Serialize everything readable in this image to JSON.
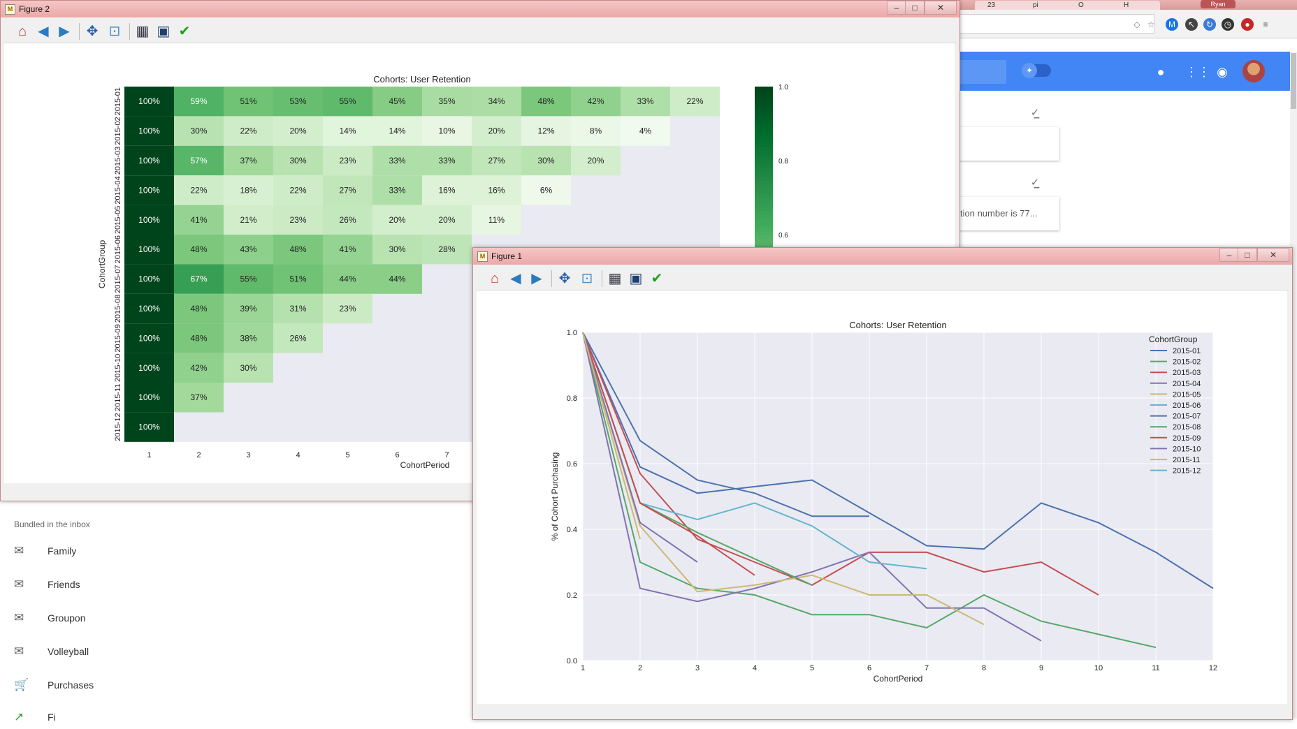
{
  "browser": {
    "tabs": [
      "23",
      "pi",
      "O",
      "H"
    ],
    "profile_label": "Ryan",
    "extension_icons": [
      "eye-slash-icon",
      "star-icon",
      "m-icon",
      "cursor-icon",
      "refresh-icon",
      "clock-icon",
      "shield-icon",
      "menu-icon"
    ]
  },
  "inbox": {
    "card1_text": "",
    "card2_text": "tion number is 77...",
    "bundles_title": "Bundled in the inbox",
    "bundles": [
      {
        "label": "Family",
        "icon": "mail-icon"
      },
      {
        "label": "Friends",
        "icon": "mail-icon"
      },
      {
        "label": "Groupon",
        "icon": "mail-icon"
      },
      {
        "label": "Volleyball",
        "icon": "mail-icon"
      },
      {
        "label": "Purchases",
        "icon": "cart-icon"
      },
      {
        "label": "Fi",
        "icon": "trend-icon"
      }
    ]
  },
  "figure2": {
    "window_title": "Figure 2",
    "toolbar": [
      "home-icon",
      "back-icon",
      "forward-icon",
      "pan-icon",
      "zoom-icon",
      "subplots-icon",
      "save-icon",
      "check-icon"
    ]
  },
  "figure1": {
    "window_title": "Figure 1",
    "toolbar": [
      "home-icon",
      "back-icon",
      "forward-icon",
      "pan-icon",
      "zoom-icon",
      "subplots-icon",
      "save-icon",
      "check-icon"
    ]
  },
  "colors": {
    "heat_low": "#f7fcf5",
    "heat_high": "#00441b",
    "plot_bg": "#eaeaf2",
    "series": [
      "#4c72b0",
      "#55a868",
      "#c44e52",
      "#8172b2",
      "#ccb974",
      "#64b5cd",
      "#4c72b0",
      "#55a868",
      "#c44e52",
      "#8172b2",
      "#ccb974",
      "#64b5cd"
    ]
  },
  "chart_data": [
    {
      "type": "heatmap",
      "title": "Cohorts: User Retention",
      "xlabel": "CohortPeriod",
      "ylabel": "CohortGroup",
      "x_ticks": [
        "1",
        "2",
        "3",
        "4",
        "5",
        "6",
        "7"
      ],
      "rows": [
        "2015-01",
        "2015-02",
        "2015-03",
        "2015-04",
        "2015-05",
        "2015-06",
        "2015-07",
        "2015-08",
        "2015-09",
        "2015-10",
        "2015-11",
        "2015-12"
      ],
      "values": [
        [
          100,
          59,
          51,
          53,
          55,
          45,
          35,
          34,
          48,
          42,
          33,
          22
        ],
        [
          100,
          30,
          22,
          20,
          14,
          14,
          10,
          20,
          12,
          8,
          4
        ],
        [
          100,
          57,
          37,
          30,
          23,
          33,
          33,
          27,
          30,
          20
        ],
        [
          100,
          22,
          18,
          22,
          27,
          33,
          16,
          16,
          6
        ],
        [
          100,
          41,
          21,
          23,
          26,
          20,
          20,
          11
        ],
        [
          100,
          48,
          43,
          48,
          41,
          30,
          28
        ],
        [
          100,
          67,
          55,
          51,
          44,
          44
        ],
        [
          100,
          48,
          39,
          31,
          23
        ],
        [
          100,
          48,
          38,
          26
        ],
        [
          100,
          42,
          30
        ],
        [
          100,
          37
        ],
        [
          100
        ]
      ],
      "colorbar_ticks": [
        "1.0",
        "0.8",
        "0.6"
      ],
      "vmin": 0,
      "vmax": 1
    },
    {
      "type": "line",
      "title": "Cohorts: User Retention",
      "xlabel": "CohortPeriod",
      "ylabel": "% of Cohort Purchasing",
      "legend_title": "CohortGroup",
      "legend_position": "top-right",
      "xlim": [
        1,
        12
      ],
      "ylim": [
        0.0,
        1.0
      ],
      "x_ticks": [
        "1",
        "2",
        "3",
        "4",
        "5",
        "6",
        "7",
        "8",
        "9",
        "10",
        "11",
        "12"
      ],
      "y_ticks": [
        "0.0",
        "0.2",
        "0.4",
        "0.6",
        "0.8",
        "1.0"
      ],
      "series": [
        {
          "name": "2015-01",
          "values": [
            1.0,
            0.59,
            0.51,
            0.53,
            0.55,
            0.45,
            0.35,
            0.34,
            0.48,
            0.42,
            0.33,
            0.22
          ]
        },
        {
          "name": "2015-02",
          "values": [
            1.0,
            0.3,
            0.22,
            0.2,
            0.14,
            0.14,
            0.1,
            0.2,
            0.12,
            0.08,
            0.04
          ]
        },
        {
          "name": "2015-03",
          "values": [
            1.0,
            0.57,
            0.37,
            0.3,
            0.23,
            0.33,
            0.33,
            0.27,
            0.3,
            0.2
          ]
        },
        {
          "name": "2015-04",
          "values": [
            1.0,
            0.22,
            0.18,
            0.22,
            0.27,
            0.33,
            0.16,
            0.16,
            0.06
          ]
        },
        {
          "name": "2015-05",
          "values": [
            1.0,
            0.41,
            0.21,
            0.23,
            0.26,
            0.2,
            0.2,
            0.11
          ]
        },
        {
          "name": "2015-06",
          "values": [
            1.0,
            0.48,
            0.43,
            0.48,
            0.41,
            0.3,
            0.28
          ]
        },
        {
          "name": "2015-07",
          "values": [
            1.0,
            0.67,
            0.55,
            0.51,
            0.44,
            0.44
          ]
        },
        {
          "name": "2015-08",
          "values": [
            1.0,
            0.48,
            0.39,
            0.31,
            0.23
          ]
        },
        {
          "name": "2015-09",
          "values": [
            1.0,
            0.48,
            0.38,
            0.26
          ]
        },
        {
          "name": "2015-10",
          "values": [
            1.0,
            0.42,
            0.3
          ]
        },
        {
          "name": "2015-11",
          "values": [
            1.0,
            0.37
          ]
        },
        {
          "name": "2015-12",
          "values": [
            1.0
          ]
        }
      ]
    }
  ]
}
